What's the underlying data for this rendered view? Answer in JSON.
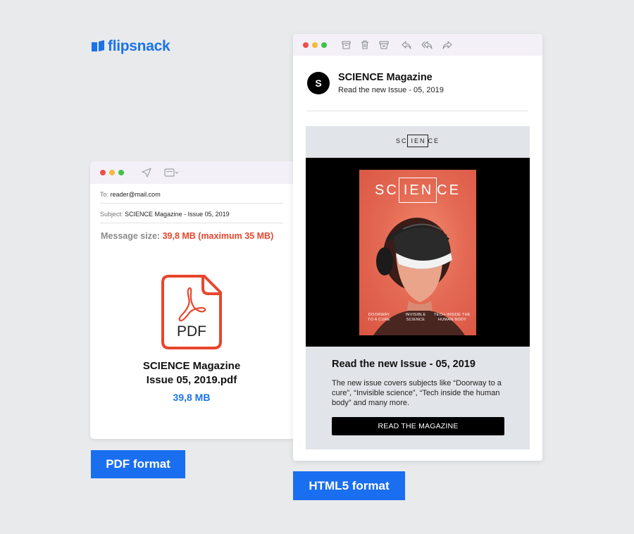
{
  "brand": {
    "name": "flipsnack",
    "color": "#1a73e8"
  },
  "pdf_email": {
    "to_label": "To:",
    "to_value": "reader@mail.com",
    "subject_label": "Subject:",
    "subject_value": "SCIENCE Magazine - Issue 05, 2019",
    "message_size_label": "Message size:",
    "message_size_value": "39,8 MB (maximum 35 MB)",
    "attachment_icon": "pdf-file-icon",
    "attachment_icon_text": "PDF",
    "attachment_name_line1": "SCIENCE Magazine",
    "attachment_name_line2": "Issue 05, 2019.pdf",
    "attachment_size": "39,8 MB",
    "toolbar_icons": [
      "send-icon",
      "calendar-icon"
    ]
  },
  "html_email": {
    "toolbar_icons": [
      "archive-icon",
      "trash-icon",
      "inbox-icon",
      "reply-icon",
      "reply-all-icon",
      "forward-icon"
    ],
    "avatar_letter": "S",
    "sender_name": "SCIENCE Magazine",
    "subject": "Read the new Issue - 05, 2019",
    "newsletter": {
      "logo_left": "SC",
      "logo_box": "IEN",
      "logo_right": "CE",
      "cover_title_left": "SC",
      "cover_title_box": "IEN",
      "cover_title_right": "CE",
      "cover_captions": [
        "DOORWAY TO A CURE",
        "INVISIBLE SCIENCE",
        "TECH INSIDE THE HUMAN BODY"
      ],
      "heading": "Read the new Issue - 05, 2019",
      "body": "The new issue covers subjects like “Doorway to a cure”, “Invisible science”, “Tech inside the human body” and many more.",
      "button_label": "READ THE MAGAZINE"
    }
  },
  "labels": {
    "pdf_format": "PDF format",
    "html5_format": "HTML5 format"
  },
  "colors": {
    "accent_blue": "#1a6ef0",
    "warning_red": "#e8462e",
    "pdf_red": "#e8462e"
  }
}
